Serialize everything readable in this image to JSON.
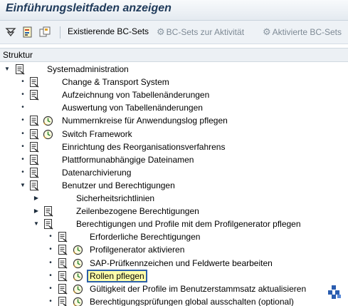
{
  "window": {
    "title": "Einführungsleitfaden anzeigen"
  },
  "toolbar": {
    "btn_existing": "Existierende BC-Sets",
    "btn_activity": "BC-Sets zur Aktivität",
    "btn_activated": "Aktivierte BC-Sets",
    "icons": [
      "filter-icon",
      "structure-icon",
      "copy-icon",
      "gear-icon"
    ]
  },
  "structure": {
    "header": "Struktur"
  },
  "tree": [
    {
      "label": "Systemadministration",
      "expander": "expanded",
      "doc": true,
      "clock": false,
      "level": 0
    },
    {
      "label": "Change & Transport System",
      "expander": "leaf",
      "doc": true,
      "clock": false,
      "level": 1
    },
    {
      "label": "Aufzeichnung von Tabellenänderungen",
      "expander": "leaf",
      "doc": true,
      "clock": false,
      "level": 1
    },
    {
      "label": "Auswertung von Tabellenänderungen",
      "expander": "leaf",
      "doc": false,
      "clock": false,
      "level": 1
    },
    {
      "label": "Nummernkreise für Anwendungslog pflegen",
      "expander": "leaf",
      "doc": true,
      "clock": true,
      "level": 1
    },
    {
      "label": "Switch Framework",
      "expander": "leaf",
      "doc": true,
      "clock": true,
      "level": 1
    },
    {
      "label": "Einrichtung des Reorganisationsverfahrens",
      "expander": "leaf",
      "doc": true,
      "clock": false,
      "level": 1
    },
    {
      "label": "Plattformunabhängige Dateinamen",
      "expander": "leaf",
      "doc": true,
      "clock": false,
      "level": 1
    },
    {
      "label": "Datenarchivierung",
      "expander": "leaf",
      "doc": true,
      "clock": false,
      "level": 1
    },
    {
      "label": "Benutzer und Berechtigungen",
      "expander": "expanded",
      "doc": true,
      "clock": false,
      "level": 1
    },
    {
      "label": "Sicherheitsrichtlinien",
      "expander": "collapsed",
      "doc": false,
      "clock": false,
      "level": 2
    },
    {
      "label": "Zeilenbezogene Berechtigungen",
      "expander": "collapsed",
      "doc": true,
      "clock": false,
      "level": 2
    },
    {
      "label": "Berechtigungen und Profile mit dem Profilgenerator pflegen",
      "expander": "expanded",
      "doc": true,
      "clock": false,
      "level": 2
    },
    {
      "label": "Erforderliche Berechtigungen",
      "expander": "leaf",
      "doc": true,
      "clock": false,
      "level": 3
    },
    {
      "label": "Profilgenerator aktivieren",
      "expander": "leaf",
      "doc": true,
      "clock": true,
      "level": 3
    },
    {
      "label": "SAP-Prüfkennzeichen und Feldwerte bearbeiten",
      "expander": "leaf",
      "doc": true,
      "clock": true,
      "level": 3
    },
    {
      "label": "Rollen pflegen",
      "expander": "leaf",
      "doc": true,
      "clock": true,
      "level": 3,
      "selected": true
    },
    {
      "label": "Gültigkeit der Profile im Benutzerstammsatz aktualisieren",
      "expander": "leaf",
      "doc": true,
      "clock": true,
      "level": 3
    },
    {
      "label": "Berechtigungsprüfungen global ausschalten (optional)",
      "expander": "leaf",
      "doc": true,
      "clock": true,
      "level": 3
    }
  ]
}
